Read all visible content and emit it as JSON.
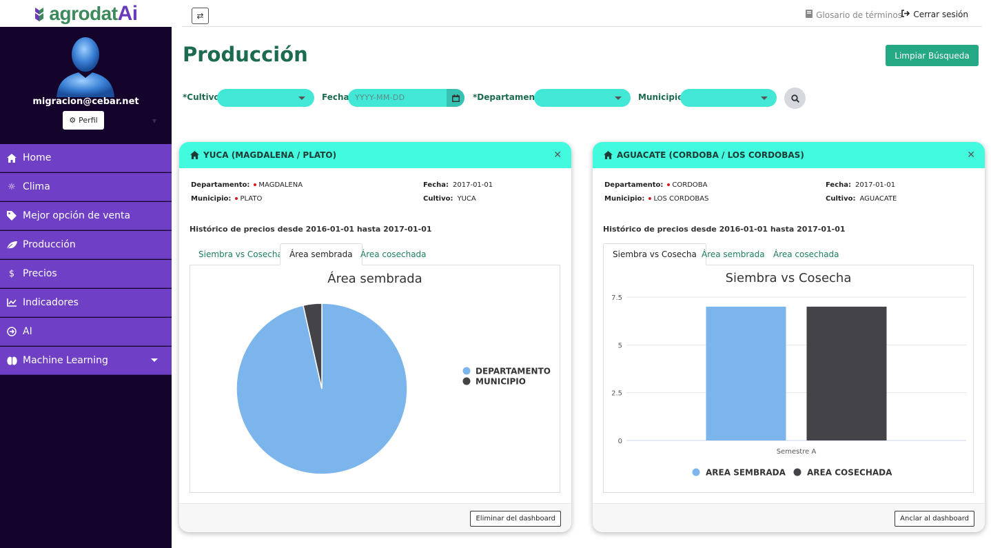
{
  "brand": {
    "name": "agrodat",
    "suffix": "Ai"
  },
  "user": {
    "email": "migracion@cebar.net",
    "profile_label": "Perfil"
  },
  "nav": [
    {
      "label": "Home",
      "icon": "home-icon"
    },
    {
      "label": "Clima",
      "icon": "sun-icon"
    },
    {
      "label": "Mejor opción de venta",
      "icon": "tag-icon"
    },
    {
      "label": "Producción",
      "icon": "leaf-icon"
    },
    {
      "label": "Precios",
      "icon": "dollar-icon"
    },
    {
      "label": "Indicadores",
      "icon": "line-chart-icon"
    },
    {
      "label": "AI",
      "icon": "arrow-circle-icon"
    },
    {
      "label": "Machine Learning",
      "icon": "brain-icon"
    }
  ],
  "topbar": {
    "glossary": "Glosario de términos",
    "logout": "Cerrar sesión"
  },
  "page": {
    "title": "Producción",
    "clear_button": "Limpiar Búsqueda"
  },
  "filters": {
    "cultivo": "*Cultivo:",
    "fecha": "Fecha:",
    "fecha_placeholder": "YYYY-MM-DD",
    "departamento": "*Departamento:",
    "municipio": "Municipio:"
  },
  "cards": [
    {
      "title": "YUCA (MAGDALENA / PLATO)",
      "departamento_label": "Departamento:",
      "departamento": "MAGDALENA",
      "municipio_label": "Municipio:",
      "municipio": "PLATO",
      "fecha_label": "Fecha:",
      "fecha": "2017-01-01",
      "cultivo_label": "Cultivo:",
      "cultivo": "YUCA",
      "history": "Histórico de precios desde 2016-01-01 hasta 2017-01-01",
      "tabs": [
        "Siembra vs Cosecha",
        "Área sembrada",
        "Área cosechada"
      ],
      "active_tab": 1,
      "footer_button": "Eliminar del dashboard"
    },
    {
      "title": "AGUACATE (CORDOBA / LOS CORDOBAS)",
      "departamento_label": "Departamento:",
      "departamento": "CORDOBA",
      "municipio_label": "Municipio:",
      "municipio": "LOS CORDOBAS",
      "fecha_label": "Fecha:",
      "fecha": "2017-01-01",
      "cultivo_label": "Cultivo:",
      "cultivo": "AGUACATE",
      "history": "Histórico de precios desde 2016-01-01 hasta 2017-01-01",
      "tabs": [
        "Siembra vs Cosecha",
        "Área sembrada",
        "Área cosechada"
      ],
      "active_tab": 0,
      "footer_button": "Anclar al dashboard"
    }
  ],
  "colors": {
    "accent": "#42fbdf",
    "nav": "#6f3fc6",
    "sidebar": "#14042b",
    "series1": "#7cb5ec",
    "series2": "#434348"
  },
  "chart_data": [
    {
      "type": "pie",
      "title": "Área sembrada",
      "categories": [
        "DEPARTAMENTO",
        "MUNICIPIO"
      ],
      "values": [
        96.5,
        3.5
      ],
      "legend": "right"
    },
    {
      "type": "bar",
      "title": "Siembra vs Cosecha",
      "categories": [
        "Semestre A"
      ],
      "series": [
        {
          "name": "AREA SEMBRADA",
          "values": [
            7
          ]
        },
        {
          "name": "AREA COSECHADA",
          "values": [
            7
          ]
        }
      ],
      "yticks": [
        "0",
        "2.5",
        "5",
        "7.5"
      ],
      "ylim": [
        0,
        7.5
      ],
      "legend": "bottom"
    }
  ]
}
